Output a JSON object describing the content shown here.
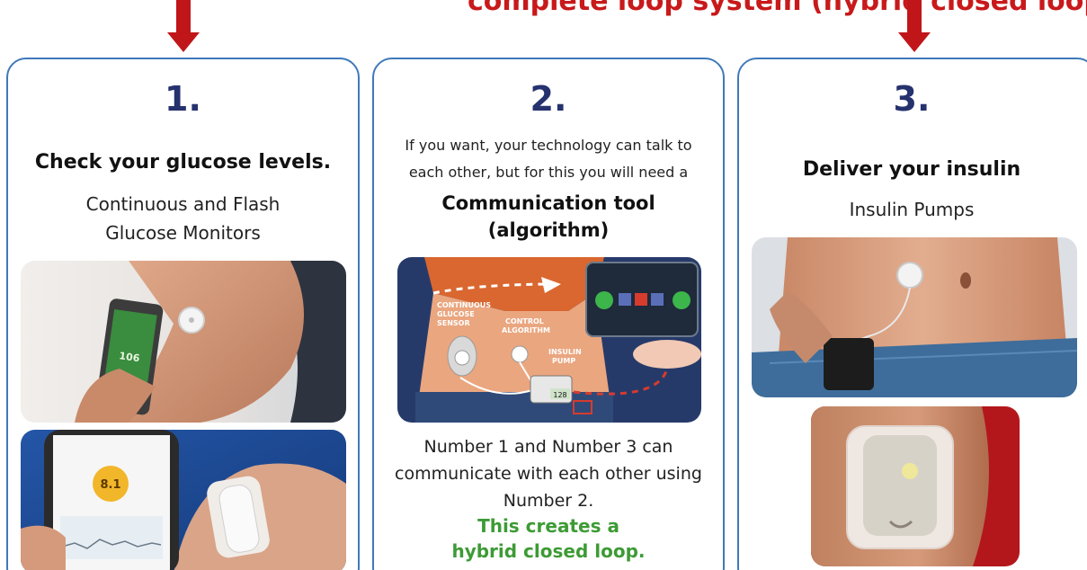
{
  "header": {
    "title_fragment": "complete loop system (hybrid closed loop)"
  },
  "panels": [
    {
      "number": "1.",
      "heading": "Check your glucose levels.",
      "subtitle_line1": "Continuous and Flash",
      "subtitle_line2": "Glucose Monitors",
      "photo1_reading": "106",
      "photo2_reading": "8.1"
    },
    {
      "number": "2.",
      "intro_line1": "If you want, your technology can talk to",
      "intro_line2": "each other, but for this you will need a",
      "heading_line1": "Communication tool",
      "heading_line2": "(algorithm)",
      "diagram_labels": {
        "sensor_line1": "CONTINUOUS",
        "sensor_line2": "GLUCOSE",
        "sensor_line3": "SENSOR",
        "algorithm_line1": "CONTROL",
        "algorithm_line2": "ALGORITHM",
        "pump_line1": "INSULIN",
        "pump_line2": "PUMP",
        "pump_reading": "128"
      },
      "body_line1": "Number 1 and Number 3 can",
      "body_line2": "communicate with each other using",
      "body_line3": "Number 2.",
      "highlight_line1": "This creates a",
      "highlight_line2": "hybrid closed loop."
    },
    {
      "number": "3.",
      "heading": "Deliver your insulin",
      "subtitle": "Insulin Pumps"
    }
  ],
  "colors": {
    "panel_border": "#3f79b9",
    "arrow_red": "#c0161a",
    "number_navy": "#26326e",
    "highlight_green": "#3d9b35"
  }
}
